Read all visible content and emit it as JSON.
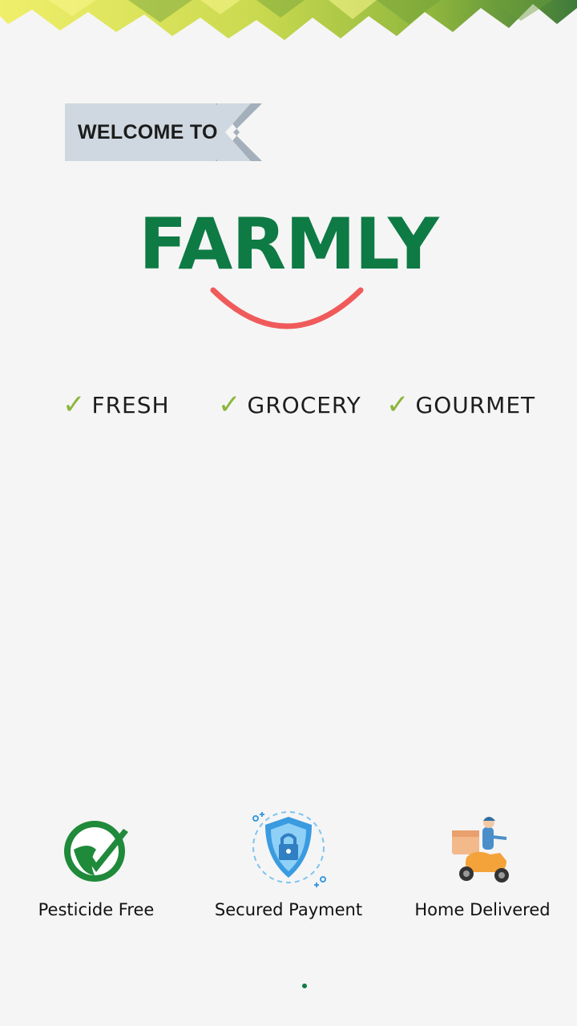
{
  "welcome": {
    "label": "WELCOME TO"
  },
  "brand": {
    "name": "FARMLY"
  },
  "features": [
    {
      "label": "FRESH",
      "icon": "check-icon"
    },
    {
      "label": "GROCERY",
      "icon": "check-icon"
    },
    {
      "label": "GOURMET",
      "icon": "check-icon"
    }
  ],
  "badges": [
    {
      "label": "Pesticide Free",
      "icon": "leaf-check-icon"
    },
    {
      "label": "Secured Payment",
      "icon": "shield-lock-icon"
    },
    {
      "label": "Home Delivered",
      "icon": "delivery-scooter-icon"
    }
  ],
  "colors": {
    "brand_green": "#0e7a44",
    "smile_red": "#f05a5a",
    "check_green": "#8ab63a",
    "ribbon": "#cfd8e0",
    "background": "#f5f5f5"
  }
}
